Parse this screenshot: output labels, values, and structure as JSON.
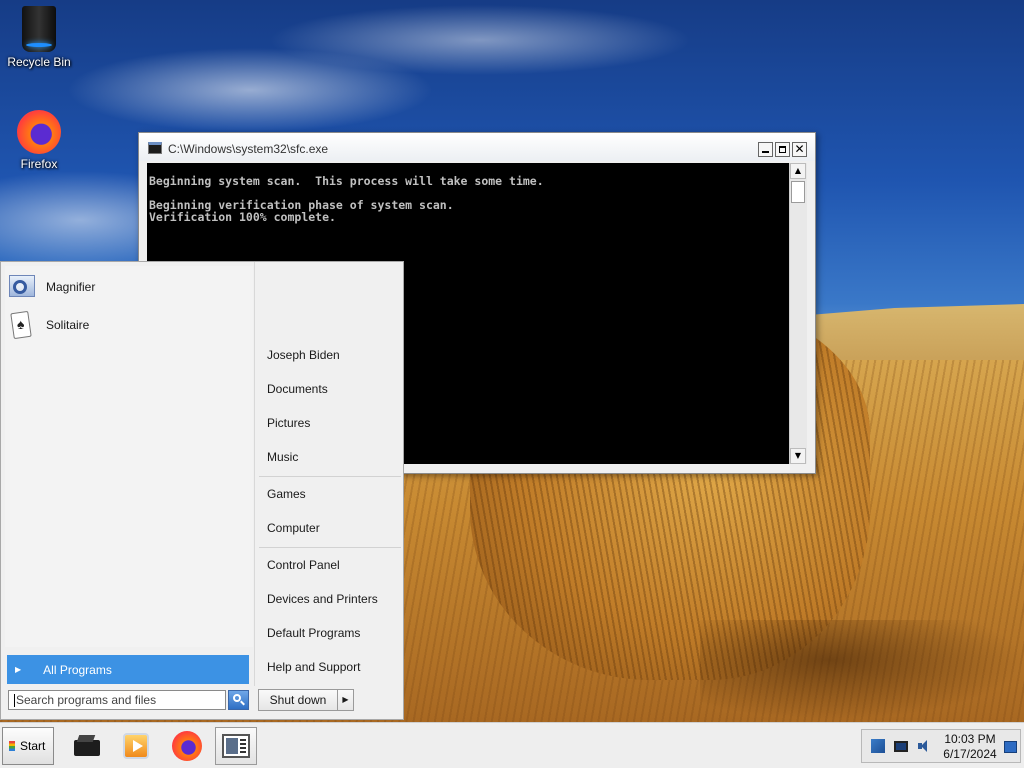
{
  "desktop": {
    "icons": [
      {
        "label": "Recycle Bin"
      },
      {
        "label": "Firefox"
      }
    ]
  },
  "console_window": {
    "title": "C:\\Windows\\system32\\sfc.exe",
    "lines": [
      "Beginning system scan.  This process will take some time.",
      "",
      "Beginning verification phase of system scan.",
      "Verification 100% complete."
    ]
  },
  "start_menu": {
    "pinned_programs": [
      {
        "label": "Magnifier",
        "icon": "magnifier-icon"
      },
      {
        "label": "Solitaire",
        "icon": "solitaire-icon"
      }
    ],
    "all_programs_label": "All Programs",
    "search_placeholder": "Search programs and files",
    "right_items": [
      "Joseph Biden",
      "Documents",
      "Pictures",
      "Music",
      "Games",
      "Computer",
      "Control Panel",
      "Devices and Printers",
      "Default Programs",
      "Help and Support"
    ],
    "shutdown_label": "Shut down"
  },
  "taskbar": {
    "start_label": "Start",
    "pinned": [
      "printer-icon",
      "media-player-icon",
      "firefox-icon",
      "command-prompt-icon"
    ],
    "clock": {
      "time": "10:03 PM",
      "date": "6/17/2024"
    }
  },
  "colors": {
    "selection_blue": "#3c92e4",
    "console_bg": "#000000",
    "console_text": "#c0c0c0"
  }
}
